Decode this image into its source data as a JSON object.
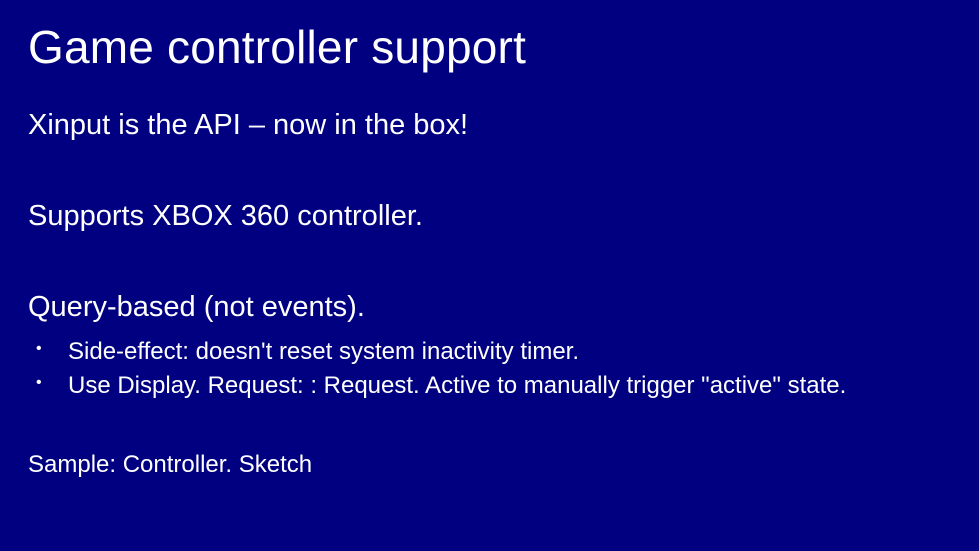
{
  "title": "Game controller support",
  "points": {
    "p1": "Xinput is the API – now in the box!",
    "p2": "Supports XBOX 360 controller.",
    "p3": "Query-based (not events)."
  },
  "subitems": {
    "s1": "Side-effect: doesn't reset system inactivity timer.",
    "s2": "Use Display. Request: : Request. Active to manually trigger \"active\" state."
  },
  "sample": "Sample: Controller. Sketch"
}
